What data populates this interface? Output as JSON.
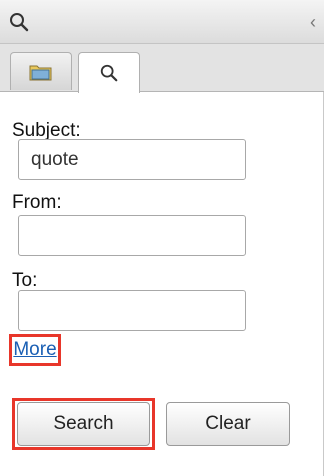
{
  "colors": {
    "highlight": "#e8362a",
    "link": "#1a5fb4"
  },
  "header": {
    "search_icon": "search-icon",
    "collapse_glyph": "‹"
  },
  "tabs": [
    {
      "icon": "folder-icon",
      "active": false
    },
    {
      "icon": "search-icon",
      "active": true
    }
  ],
  "form": {
    "subject_label": "Subject:",
    "subject_value": "quote",
    "from_label": "From:",
    "from_value": "",
    "to_label": "To:",
    "to_value": "",
    "more_link": "More"
  },
  "buttons": {
    "search": "Search",
    "clear": "Clear"
  }
}
